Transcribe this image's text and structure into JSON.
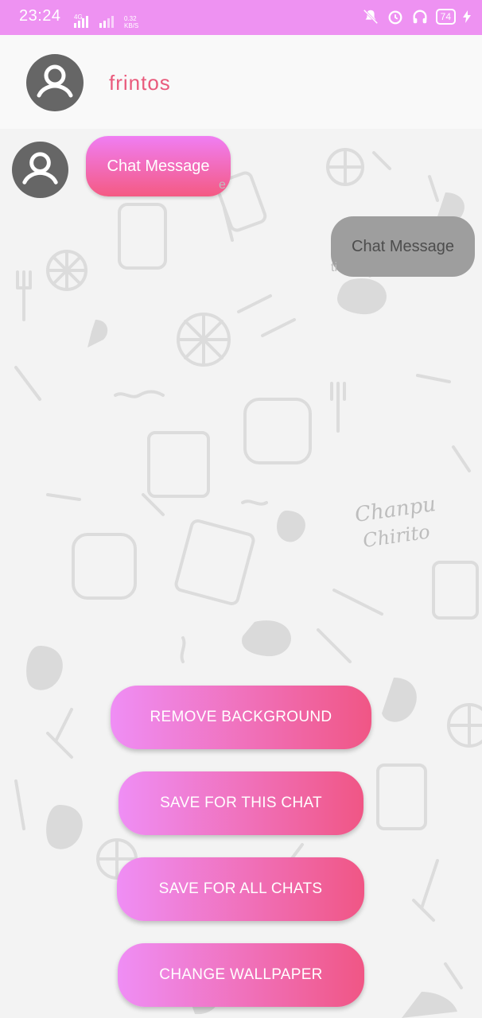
{
  "status_bar": {
    "time": "23:24",
    "network": "4G",
    "speed_value": "0.32",
    "speed_unit": "KB/S",
    "battery": "74",
    "icons": [
      "mute-icon",
      "alarm-icon",
      "headphones-icon",
      "battery-icon",
      "charging-icon"
    ]
  },
  "header": {
    "title": "frintos",
    "avatar_icon": "person-avatar-icon"
  },
  "messages": [
    {
      "direction": "incoming",
      "text": "Chat Message"
    },
    {
      "direction": "outgoing",
      "text": "Chat Message"
    }
  ],
  "buttons": {
    "remove_background": "REMOVE BACKGROUND",
    "save_this_chat": "SAVE FOR THIS CHAT",
    "save_all_chats": "SAVE FOR ALL CHATS",
    "change_wallpaper": "CHANGE WALLPAPER"
  },
  "colors": {
    "status_bar": "#ee92f2",
    "title": "#e95a7c",
    "gradient_start": "#ef8ef5",
    "gradient_end": "#f05685",
    "outgoing_bubble": "#9e9e9e"
  }
}
